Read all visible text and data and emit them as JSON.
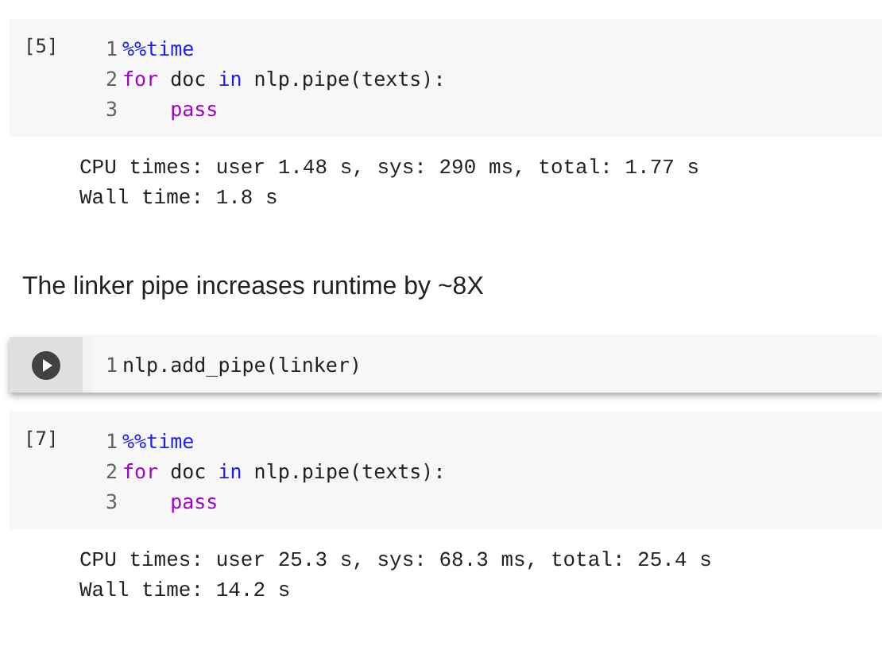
{
  "cells": [
    {
      "kind": "code",
      "selected": false,
      "execution_count": "[5]",
      "lines": [
        {
          "number": "1",
          "tokens": [
            {
              "kind": "magic",
              "text": "%%time"
            }
          ]
        },
        {
          "number": "2",
          "tokens": [
            {
              "kind": "keyword",
              "text": "for"
            },
            {
              "kind": "plain",
              "text": " doc "
            },
            {
              "kind": "operator",
              "text": "in"
            },
            {
              "kind": "plain",
              "text": " nlp.pipe(texts):"
            }
          ]
        },
        {
          "number": "3",
          "indented": true,
          "tokens": [
            {
              "kind": "keyword",
              "text": "pass"
            }
          ]
        }
      ],
      "output": [
        "CPU times: user 1.48 s, sys: 290 ms, total: 1.77 s",
        "Wall time: 1.8 s"
      ]
    },
    {
      "kind": "text",
      "text": "The linker pipe increases runtime by ~8X"
    },
    {
      "kind": "code",
      "selected": true,
      "lines": [
        {
          "number": "1",
          "tokens": [
            {
              "kind": "plain",
              "text": "nlp.add_pipe(linker)"
            }
          ]
        }
      ]
    },
    {
      "kind": "code",
      "selected": false,
      "execution_count": "[7]",
      "lines": [
        {
          "number": "1",
          "tokens": [
            {
              "kind": "magic",
              "text": "%%time"
            }
          ]
        },
        {
          "number": "2",
          "tokens": [
            {
              "kind": "keyword",
              "text": "for"
            },
            {
              "kind": "plain",
              "text": " doc "
            },
            {
              "kind": "operator",
              "text": "in"
            },
            {
              "kind": "plain",
              "text": " nlp.pipe(texts):"
            }
          ]
        },
        {
          "number": "3",
          "indented": true,
          "tokens": [
            {
              "kind": "keyword",
              "text": "pass"
            }
          ]
        }
      ],
      "output": [
        "CPU times: user 25.3 s, sys: 68.3 ms, total: 25.4 s",
        "Wall time: 14.2 s"
      ]
    }
  ]
}
